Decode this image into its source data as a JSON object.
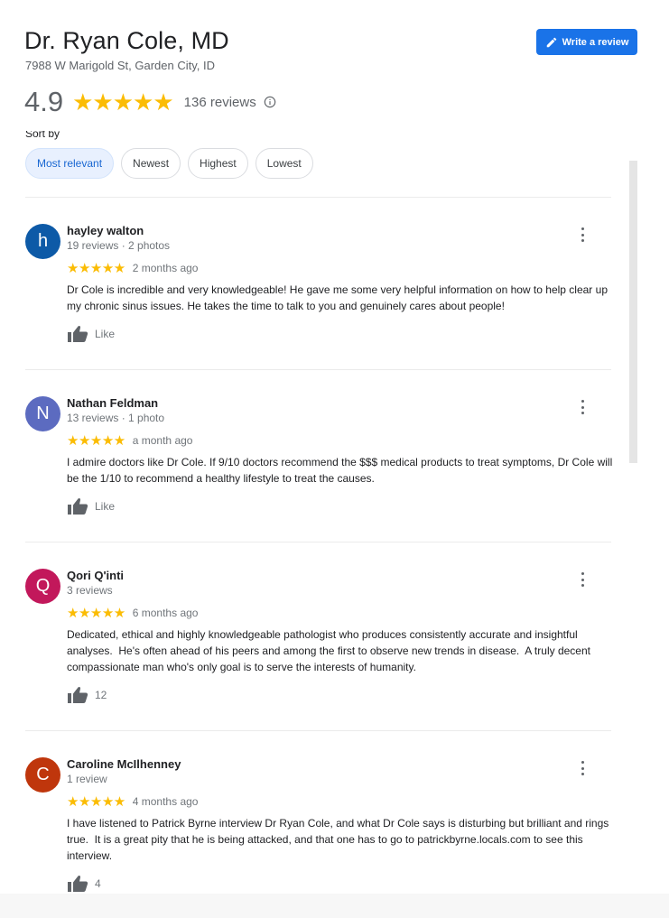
{
  "header": {
    "title": "Dr. Ryan Cole, MD",
    "address": "7988 W Marigold St, Garden City, ID",
    "write_review_label": "Write a review"
  },
  "rating": {
    "score": "4.9",
    "stars": "★★★★★",
    "count_label": "136 reviews"
  },
  "sort": {
    "label": "Sort by",
    "options": [
      "Most relevant",
      "Newest",
      "Highest",
      "Lowest"
    ],
    "selected": "Most relevant"
  },
  "colors": {
    "accent": "#1a73e8",
    "star": "#fbbc04"
  },
  "reviews": [
    {
      "initial": "h",
      "avatar_color": "#0d5aa7",
      "name": "hayley walton",
      "meta": "19 reviews · 2 photos",
      "stars": "★★★★★",
      "date": "2 months ago",
      "text": "Dr Cole is incredible and very knowledgeable! He gave me some very helpful information on how to help clear up my chronic sinus issues. He takes the time to talk to you and genuinely cares about people!",
      "like_label": "Like"
    },
    {
      "initial": "N",
      "avatar_color": "#5c6bc0",
      "name": "Nathan Feldman",
      "meta": "13 reviews · 1 photo",
      "stars": "★★★★★",
      "date": "a month ago",
      "text": "I admire doctors like Dr Cole. If 9/10 doctors recommend the $$$ medical products to treat symptoms, Dr Cole will be the 1/10 to recommend a healthy lifestyle to treat the causes.",
      "like_label": "Like"
    },
    {
      "initial": "Q",
      "avatar_color": "#c2185b",
      "name": "Qori Q'inti",
      "meta": "3 reviews",
      "stars": "★★★★★",
      "date": "6 months ago",
      "text": "Dedicated, ethical and highly knowledgeable pathologist who produces consistently accurate and insightful analyses.  He's often ahead of his peers and among the first to observe new trends in disease.  A truly decent compassionate man who's only goal is to serve the interests of humanity.",
      "like_label": "12"
    },
    {
      "initial": "C",
      "avatar_color": "#bf360c",
      "name": "Caroline McIlhenney",
      "meta": "1 review",
      "stars": "★★★★★",
      "date": "4 months ago",
      "text": "I have listened to Patrick Byrne interview Dr Ryan Cole, and what Dr Cole says is disturbing but brilliant and rings true.  It is a great pity that he is being attacked, and that one has to go to patrickbyrne.locals.com to see this interview.",
      "like_label": "4"
    }
  ]
}
